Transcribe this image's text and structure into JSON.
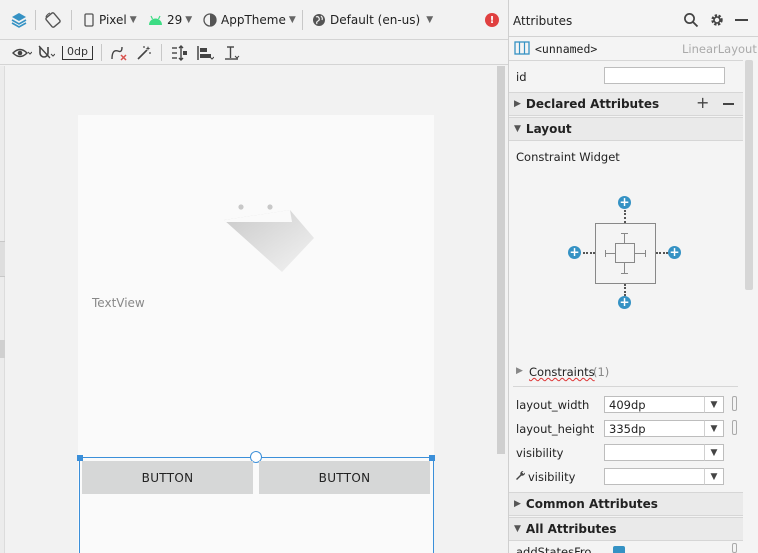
{
  "toolbar": {
    "device": "Pixel",
    "api_level": "29",
    "theme": "AppTheme",
    "locale": "Default (en-us)",
    "default_margin": "0dp"
  },
  "canvas": {
    "textview_label": "TextView",
    "button1_label": "BUTTON",
    "button2_label": "BUTTON"
  },
  "attributes": {
    "title": "Attributes",
    "component_name": "<unnamed>",
    "component_type": "LinearLayout",
    "id_label": "id",
    "id_value": "",
    "declared_section": "Declared Attributes",
    "layout_section": "Layout",
    "constraint_widget_label": "Constraint Widget",
    "constraints_label": "Constraints",
    "constraints_count": "(1)",
    "layout_width_label": "layout_width",
    "layout_width_value": "409dp",
    "layout_height_label": "layout_height",
    "layout_height_value": "335dp",
    "visibility_label": "visibility",
    "visibility_value": "",
    "tools_visibility_label": "visibility",
    "tools_visibility_value": "",
    "common_section": "Common Attributes",
    "all_section": "All Attributes",
    "cutoff_attr_label": "addStatesFro"
  },
  "colors": {
    "accent_blue": "#3592c4",
    "selection_blue": "#3b8fd9",
    "error_red": "#e04040",
    "android_green": "#3ddc84"
  }
}
